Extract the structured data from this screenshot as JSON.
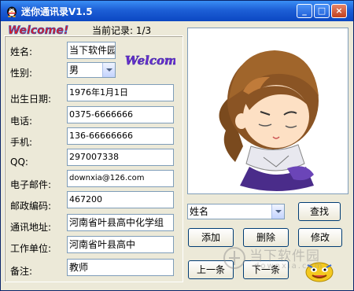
{
  "window": {
    "title": "迷你通讯录V1.5",
    "controls": {
      "minimize": "_",
      "maximize": "□",
      "close": "×"
    }
  },
  "header": {
    "logo_text": "Welcome!",
    "record_count": "当前记录: 1/3"
  },
  "form": {
    "name_label": "姓名:",
    "name_value": "当下软件园",
    "gender_label": "性别:",
    "gender_value": "男",
    "welcome_badge": "Welcome",
    "birth_label": "出生日期:",
    "birth_value": "1976年1月1日",
    "phone_label": "电话:",
    "phone_value": "0375-6666666",
    "mobile_label": "手机:",
    "mobile_value": "136-66666666",
    "qq_label": "QQ:",
    "qq_value": "297007338",
    "email_label": "电子邮件:",
    "email_value": "downxia@126.com",
    "zip_label": "邮政编码:",
    "zip_value": "467200",
    "address_label": "通讯地址:",
    "address_value": "河南省叶县高中化学组",
    "work_label": "工作单位:",
    "work_value": "河南省叶县高中",
    "note_label": "备注:",
    "note_value": "教师"
  },
  "search": {
    "field_value": "姓名",
    "search_button": "查找"
  },
  "actions": {
    "add": "添加",
    "delete": "删除",
    "edit": "修改",
    "prev": "上一条",
    "next": "下一条"
  },
  "watermark": {
    "text": "当下软件园",
    "sub": "downxia.com"
  },
  "colors": {
    "titlebar": "#0b47c2",
    "window_bg": "#ece9d8",
    "button_border": "#003c74"
  }
}
